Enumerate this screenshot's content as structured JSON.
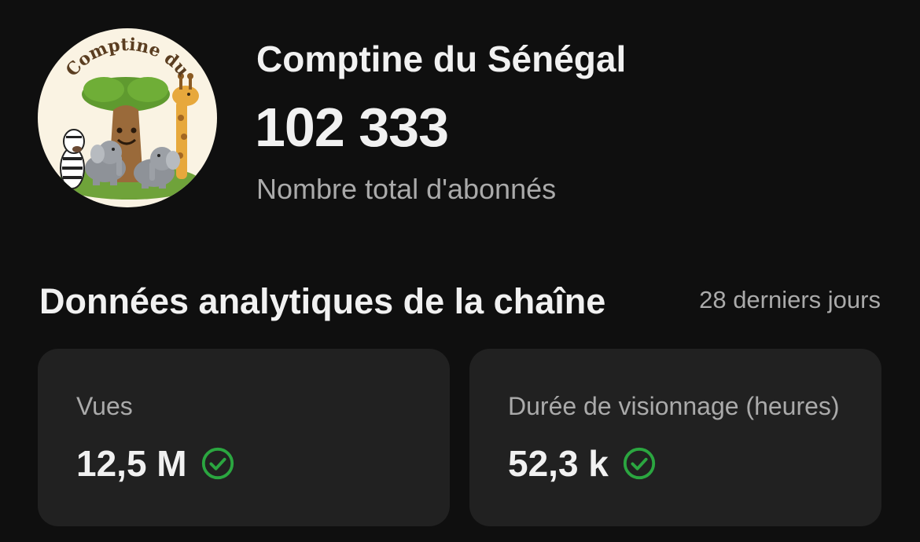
{
  "channel": {
    "avatar_text": "Comptine du",
    "name": "Comptine du Sénégal",
    "subscriber_count": "102 333",
    "subscriber_label": "Nombre total d'abonnés"
  },
  "analytics": {
    "title": "Données analytiques de la chaîne",
    "period": "28 derniers jours",
    "cards": [
      {
        "label": "Vues",
        "value": "12,5 M",
        "status_icon": "check-circle-icon"
      },
      {
        "label": "Durée de visionnage (heures)",
        "value": "52,3 k",
        "status_icon": "check-circle-icon"
      }
    ]
  },
  "colors": {
    "background": "#0f0f0f",
    "card": "#212121",
    "text_primary": "#f1f1f1",
    "text_secondary": "#aaaaaa",
    "success": "#2ba640"
  }
}
